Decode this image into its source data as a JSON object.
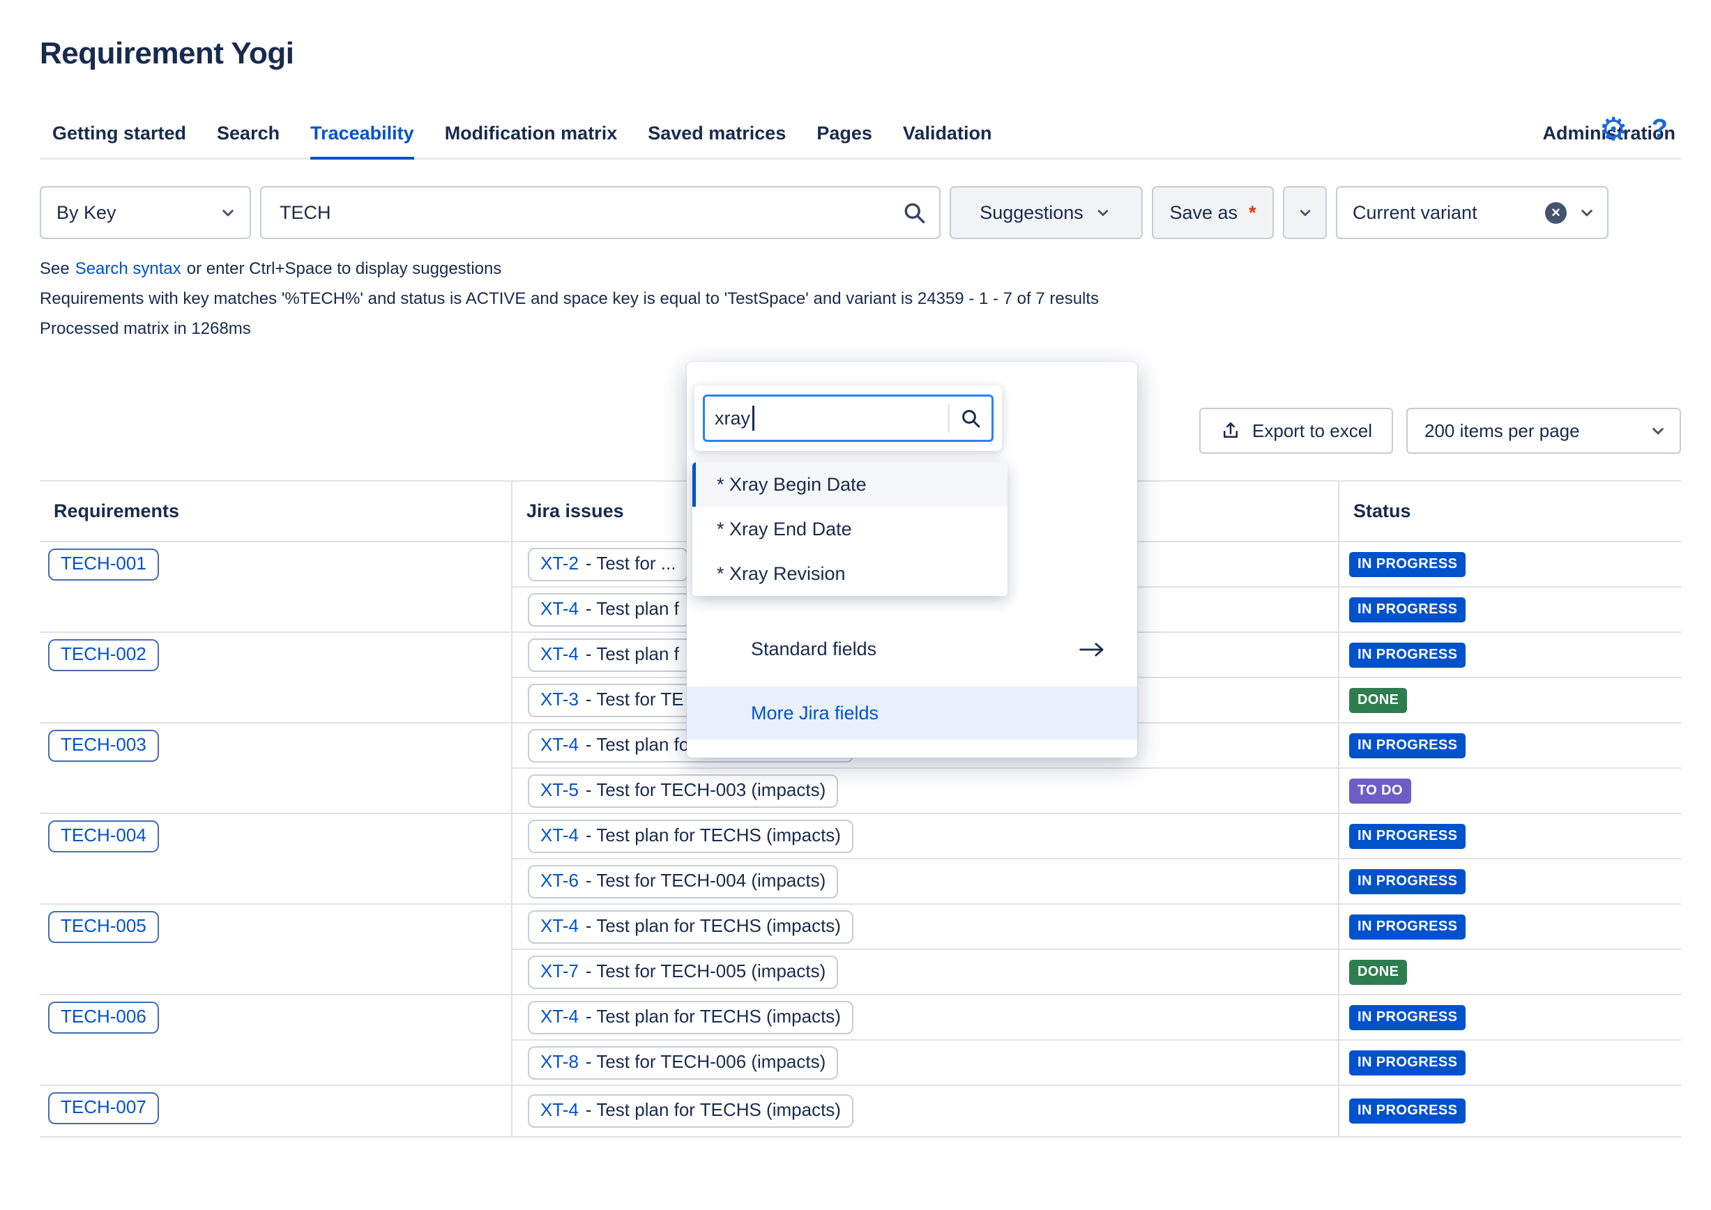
{
  "app": {
    "title": "Requirement Yogi"
  },
  "nav": {
    "tabs": [
      {
        "label": "Getting started",
        "active": false
      },
      {
        "label": "Search",
        "active": false
      },
      {
        "label": "Traceability",
        "active": true
      },
      {
        "label": "Modification matrix",
        "active": false
      },
      {
        "label": "Saved matrices",
        "active": false
      },
      {
        "label": "Pages",
        "active": false
      },
      {
        "label": "Validation",
        "active": false
      }
    ],
    "right_tab": "Administration"
  },
  "toolbar": {
    "mode_select": "By Key",
    "search_value": "TECH",
    "suggestions_button": "Suggestions",
    "save_as_button": "Save as",
    "required_marker": "*",
    "variant_select": "Current variant"
  },
  "hints": {
    "prefix": "See",
    "link": "Search syntax",
    "suffix": "or enter Ctrl+Space to display suggestions",
    "results_summary": "Requirements with key matches '%TECH%' and status is ACTIVE and space key is equal to 'TestSpace' and variant is 24359 - 1 - 7 of 7 results",
    "processed": "Processed matrix in 1268ms"
  },
  "controls": {
    "export_button": "Export to excel",
    "page_size_select": "200 items per page"
  },
  "popup": {
    "search_value": "xray",
    "results": [
      "* Xray Begin Date",
      "* Xray End Date",
      "* Xray Revision"
    ],
    "selected_index": 0,
    "standard_fields": "Standard fields",
    "more_jira_fields": "More Jira fields"
  },
  "table": {
    "headers": [
      "Requirements",
      "Jira issues",
      "Status"
    ],
    "groups": [
      {
        "requirement": "TECH-001",
        "issues": [
          {
            "key": "XT-2",
            "text": "- Test for ...",
            "status": "IN PROGRESS"
          },
          {
            "key": "XT-4",
            "text": "- Test plan f",
            "status": "IN PROGRESS"
          }
        ]
      },
      {
        "requirement": "TECH-002",
        "issues": [
          {
            "key": "XT-4",
            "text": "- Test plan f",
            "status": "IN PROGRESS"
          },
          {
            "key": "XT-3",
            "text": "- Test for TE",
            "status": "DONE"
          }
        ]
      },
      {
        "requirement": "TECH-003",
        "issues": [
          {
            "key": "XT-4",
            "text": "- Test plan for TECHS (impacts)",
            "status": "IN PROGRESS"
          },
          {
            "key": "XT-5",
            "text": "- Test for TECH-003 (impacts)",
            "status": "TO DO"
          }
        ]
      },
      {
        "requirement": "TECH-004",
        "issues": [
          {
            "key": "XT-4",
            "text": "- Test plan for TECHS (impacts)",
            "status": "IN PROGRESS"
          },
          {
            "key": "XT-6",
            "text": "- Test for TECH-004 (impacts)",
            "status": "IN PROGRESS"
          }
        ]
      },
      {
        "requirement": "TECH-005",
        "issues": [
          {
            "key": "XT-4",
            "text": "- Test plan for TECHS (impacts)",
            "status": "IN PROGRESS"
          },
          {
            "key": "XT-7",
            "text": "- Test for TECH-005 (impacts)",
            "status": "DONE"
          }
        ]
      },
      {
        "requirement": "TECH-006",
        "issues": [
          {
            "key": "XT-4",
            "text": "- Test plan for TECHS (impacts)",
            "status": "IN PROGRESS"
          },
          {
            "key": "XT-8",
            "text": "- Test for TECH-006 (impacts)",
            "status": "IN PROGRESS"
          }
        ]
      },
      {
        "requirement": "TECH-007",
        "issues": [
          {
            "key": "XT-4",
            "text": "- Test plan for TECHS (impacts)",
            "status": "IN PROGRESS"
          }
        ]
      }
    ]
  },
  "colors": {
    "accent_blue": "#0052CC",
    "status_in_progress": "#0052CC",
    "status_done": "#2E7D4F",
    "status_to_do": "#6E5DC6",
    "popup_selected_bar": "#0052CC",
    "more_fields_bg": "#E8F0FB"
  }
}
